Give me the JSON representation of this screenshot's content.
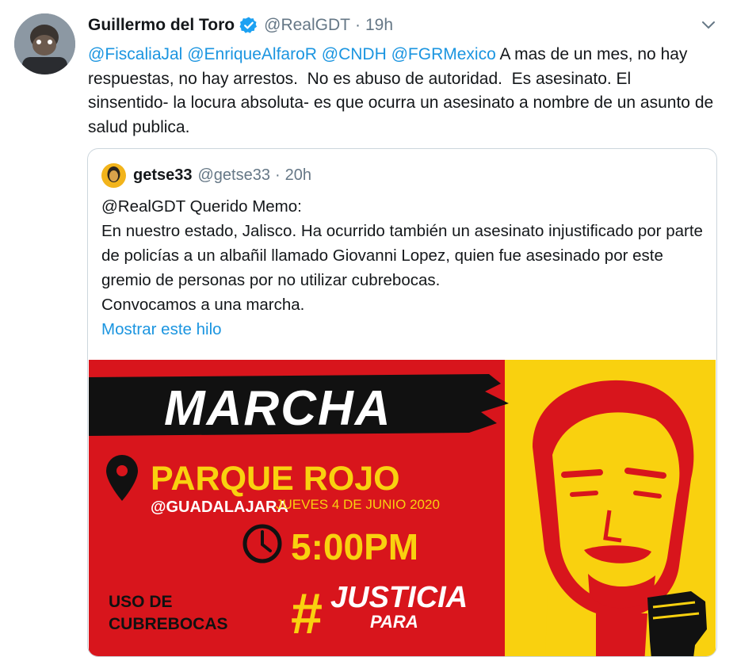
{
  "tweet": {
    "author_name": "Guillermo del Toro",
    "author_handle": "@RealGDT",
    "separator": "·",
    "time": "19h",
    "mentions": [
      "@FiscaliaJal",
      "@EnriqueAlfaroR",
      "@CNDH",
      "@FGRMexico"
    ],
    "body": " A mas de un mes, no hay respuestas, no hay arrestos.  No es abuso de autoridad.  Es asesinato. El sinsentido- la locura absoluta- es que ocurra un asesinato a nombre de un asunto de salud publica."
  },
  "quote": {
    "author_name": "getse33",
    "author_handle": "@getse33",
    "separator": "·",
    "time": "20h",
    "body": "@RealGDT Querido Memo:\nEn nuestro estado, Jalisco. Ha ocurrido también un asesinato injustificado por parte de policías a un albañil llamado Giovanni Lopez, quien fue asesinado por este gremio de personas por no utilizar cubrebocas.\nConvocamos a una marcha.",
    "show_thread": "Mostrar este hilo"
  },
  "poster": {
    "title": "MARCHA",
    "place": "PARQUE ROJO",
    "city": "@GUADALAJARA",
    "date": "JUEVES 4 DE JUNIO 2020",
    "hour": "5:00PM",
    "mask_line1": "USO DE",
    "mask_line2": "CUBREBOCAS",
    "hashtag_mark": "#",
    "hashtag_word1": "JUSTICIA",
    "hashtag_word2": "PARA",
    "colors": {
      "red": "#d8151c",
      "yellow": "#f9d10f",
      "black": "#111111",
      "white": "#ffffff"
    }
  },
  "colors": {
    "link": "#1b95e0",
    "muted": "#657786",
    "border": "#ccd6dd"
  }
}
